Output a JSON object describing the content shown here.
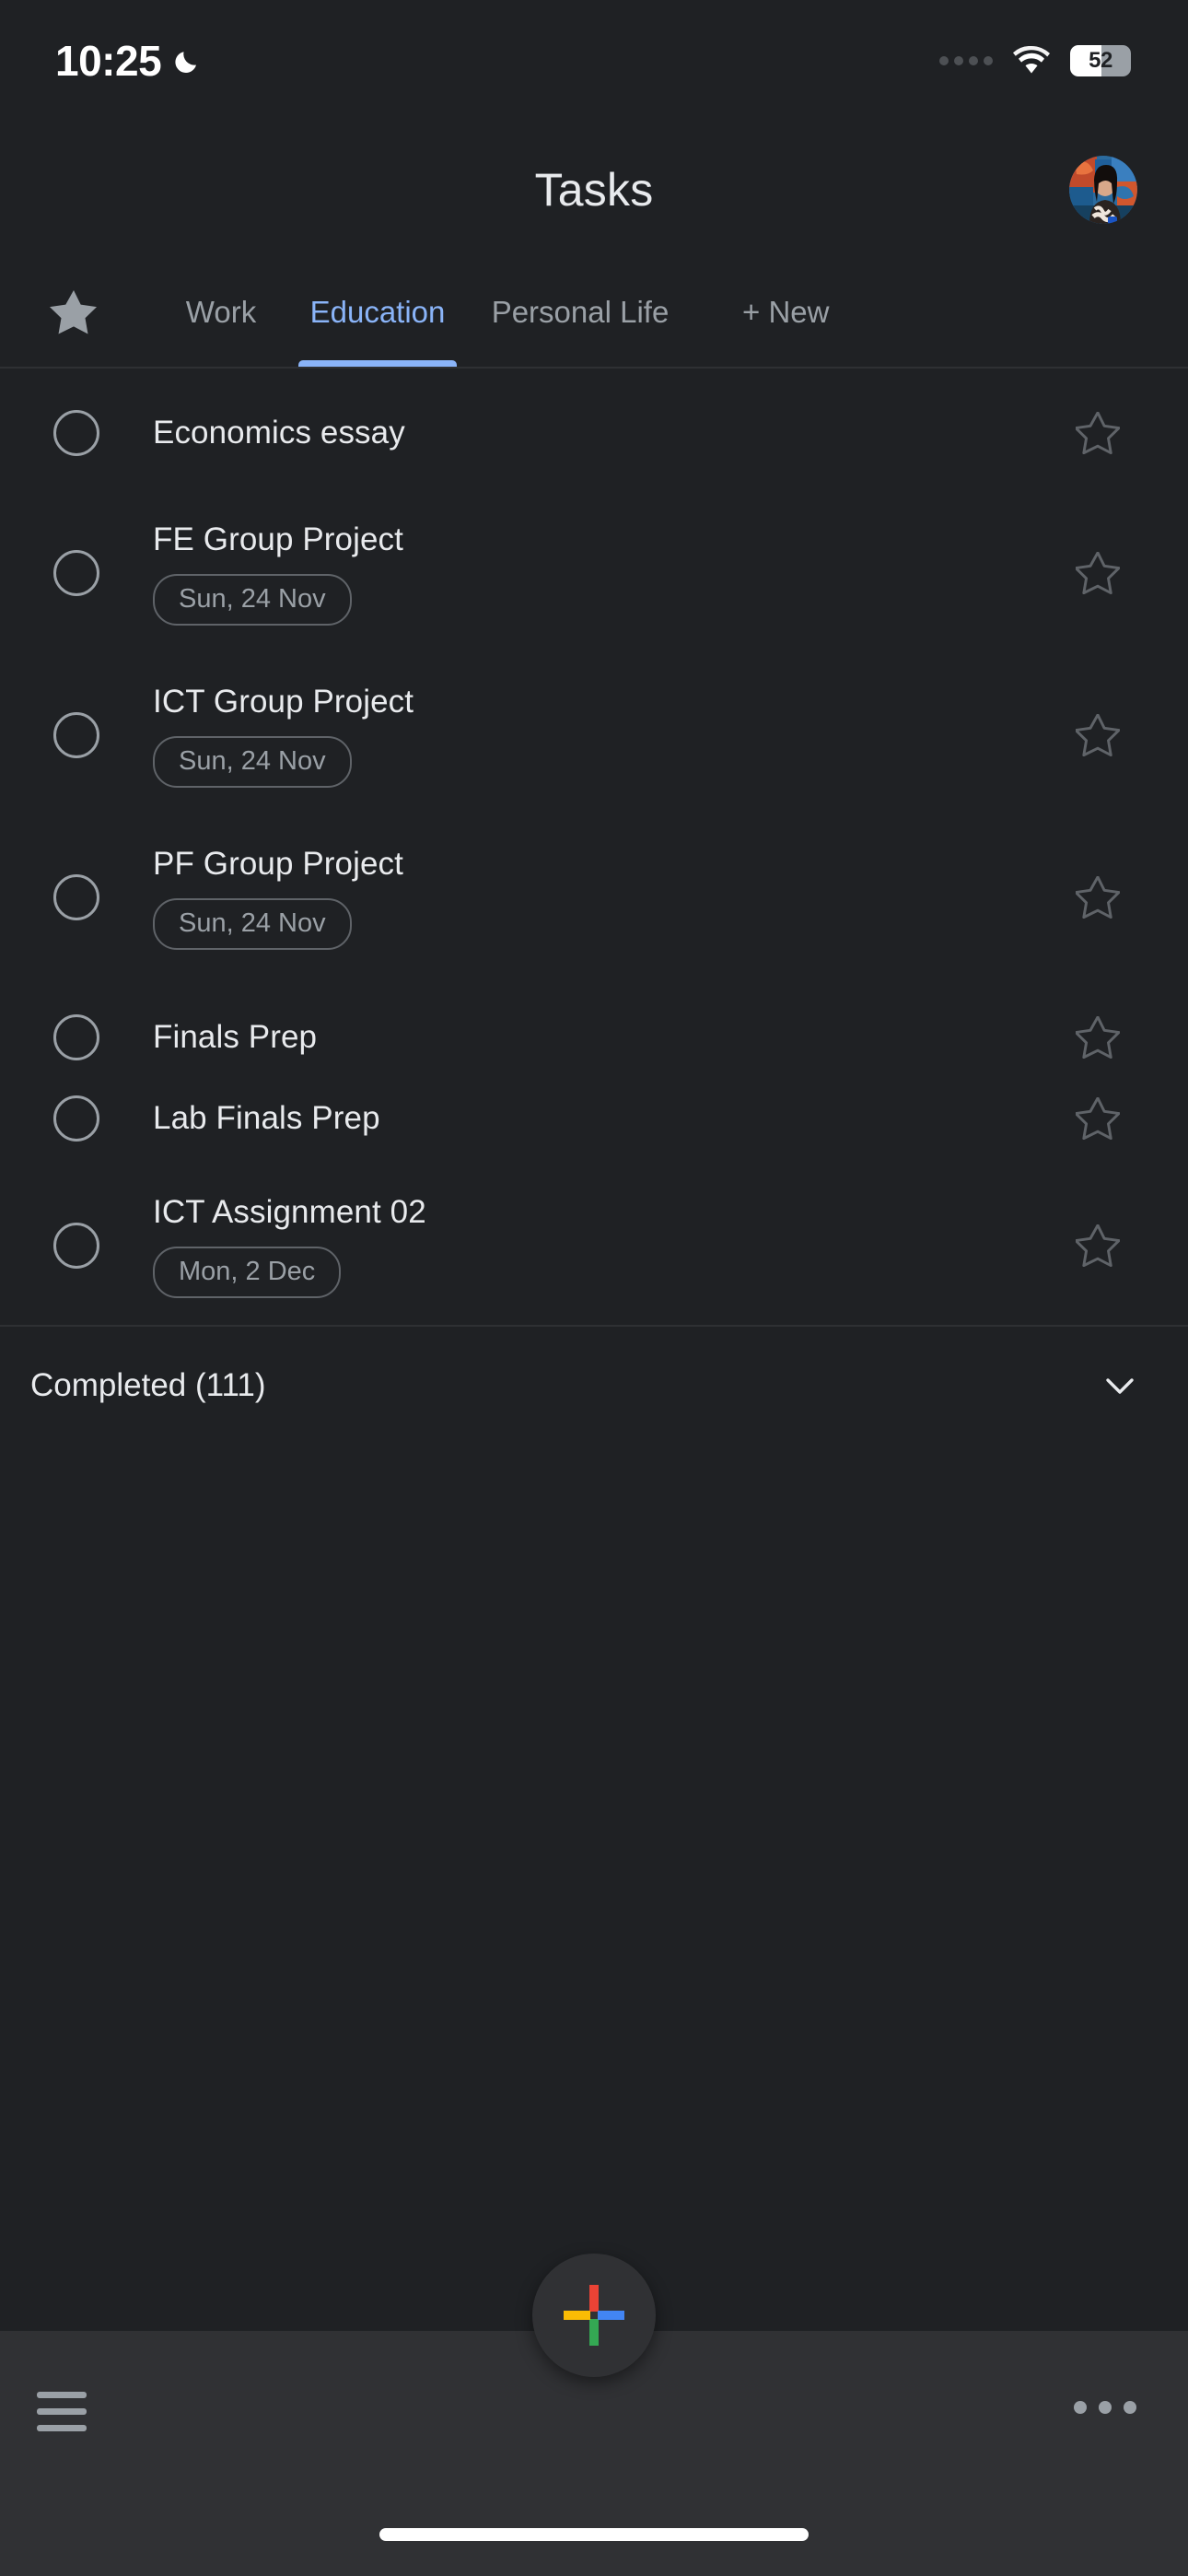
{
  "status_bar": {
    "time": "10:25",
    "dnd_icon": "crescent-moon-icon",
    "signal_icon": "signal-dots-icon",
    "wifi_icon": "wifi-icon",
    "battery_percent": "52",
    "battery_icon": "battery-icon"
  },
  "header": {
    "title": "Tasks",
    "avatar_icon": "user-avatar"
  },
  "tabs": {
    "star_icon": "star-filled-icon",
    "items": [
      {
        "label": "Work",
        "active": false
      },
      {
        "label": "Education",
        "active": true
      },
      {
        "label": "Personal Life",
        "active": false
      },
      {
        "label": "+ New",
        "active": false
      }
    ],
    "active_color": "#8ab4f8",
    "inactive_color": "#9aa0a6"
  },
  "tasks": [
    {
      "title": "Economics essay",
      "date": "",
      "checkbox_icon": "checkbox-circle-icon",
      "star_icon": "star-outline-icon"
    },
    {
      "title": "FE Group Project",
      "date": "Sun, 24 Nov",
      "checkbox_icon": "checkbox-circle-icon",
      "star_icon": "star-outline-icon"
    },
    {
      "title": "ICT Group Project",
      "date": "Sun, 24 Nov",
      "checkbox_icon": "checkbox-circle-icon",
      "star_icon": "star-outline-icon"
    },
    {
      "title": "PF Group Project",
      "date": "Sun, 24 Nov",
      "checkbox_icon": "checkbox-circle-icon",
      "star_icon": "star-outline-icon"
    },
    {
      "title": "Finals Prep",
      "date": "",
      "checkbox_icon": "checkbox-circle-icon",
      "star_icon": "star-outline-icon"
    },
    {
      "title": "Lab Finals Prep",
      "date": "",
      "checkbox_icon": "checkbox-circle-icon",
      "star_icon": "star-outline-icon"
    },
    {
      "title": "ICT Assignment 02",
      "date": "Mon, 2 Dec",
      "checkbox_icon": "checkbox-circle-icon",
      "star_icon": "star-outline-icon"
    }
  ],
  "completed": {
    "label": "Completed (111)",
    "count": 111,
    "chevron_icon": "chevron-down-icon"
  },
  "bottom_bar": {
    "menu_icon": "hamburger-menu-icon",
    "add_icon": "google-plus-icon",
    "more_icon": "more-options-icon",
    "home_indicator": "home-indicator"
  },
  "colors": {
    "background": "#1f2124",
    "bottom_bar": "#303134",
    "accent_blue": "#8ab4f8",
    "text_primary": "#e8eaed",
    "text_secondary": "#9aa0a6",
    "google_red": "#ea4335",
    "google_yellow": "#fbbc04",
    "google_blue": "#4285f4",
    "google_green": "#34a853"
  }
}
